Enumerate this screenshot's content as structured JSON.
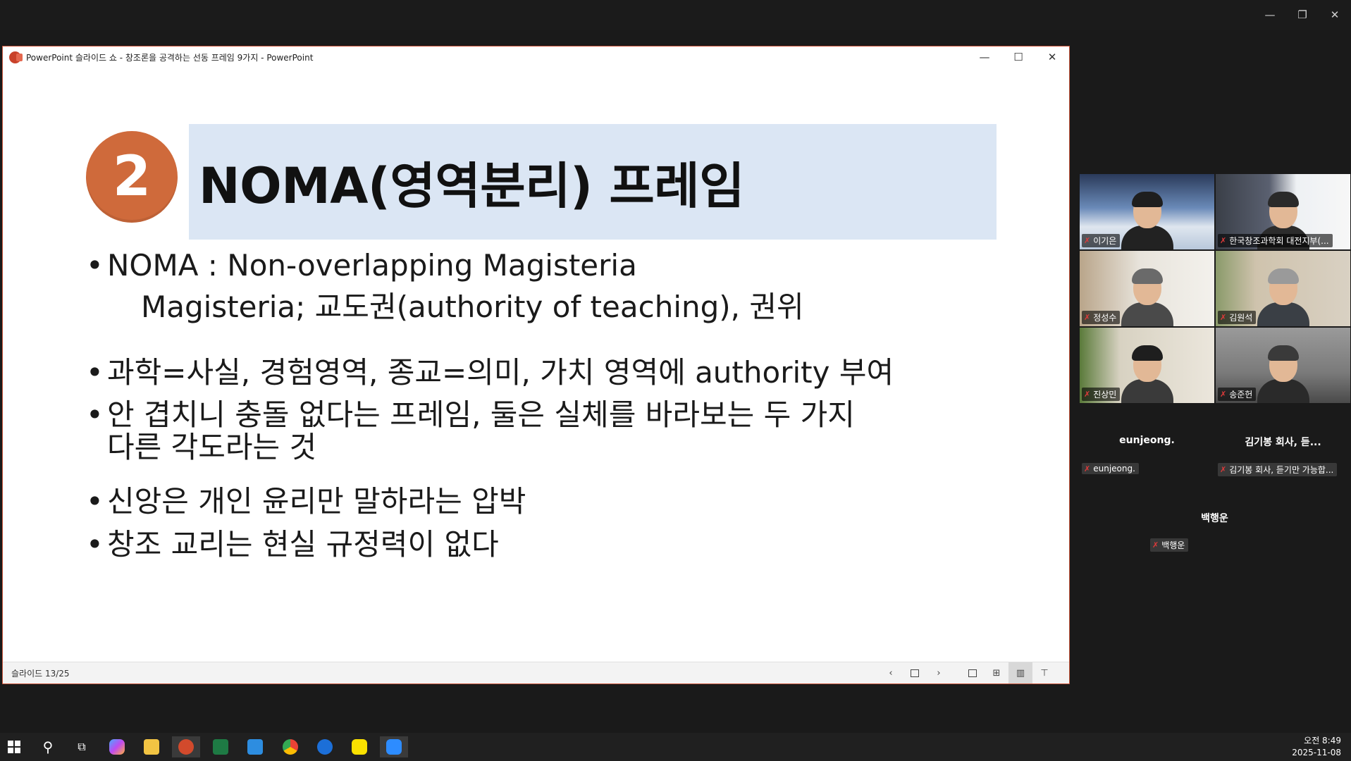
{
  "ppt": {
    "window_title": "PowerPoint 슬라이드 쇼  -  창조론을 공격하는 선동 프레임 9가지 - PowerPoint",
    "slide_counter": "슬라이드 13/25"
  },
  "slide": {
    "number": "2",
    "title": "NOMA(영역분리) 프레임",
    "bullets": [
      {
        "line1": "NOMA : Non-overlapping Magisteria",
        "line2": ""
      },
      {
        "line1": "과학=사실, 경험영역, 종교=의미, 가치 영역에 authority 부여",
        "line2": ""
      },
      {
        "line1": "안 겹치니 충돌 없다는 프레임, 둘은 실체를 바라보는 두 가지",
        "line2": "다른 각도라는 것"
      },
      {
        "line1": "신앙은 개인 윤리만 말하라는 압박",
        "line2": ""
      },
      {
        "line1": "창조 교리는 현실 규정력이 없다",
        "line2": ""
      }
    ],
    "sub_line": "Magisteria; 교도권(authority of teaching), 권위"
  },
  "participants": {
    "tiles": [
      {
        "name": "이기은"
      },
      {
        "name": "한국창조과학회 대전지부(..."
      },
      {
        "name": "정성수"
      },
      {
        "name": "김원석"
      },
      {
        "name": "진상민"
      },
      {
        "name": "송준헌"
      }
    ],
    "name_only": [
      {
        "display": "eunjeong.",
        "tag": "eunjeong."
      },
      {
        "display": "김기봉 회사, 듣...",
        "tag": "김기봉 회사, 듣기만 가능합..."
      },
      {
        "display": "백행운",
        "tag": "백행운"
      }
    ]
  },
  "taskbar": {
    "time": "오전 8:49",
    "date": "2025-11-08"
  },
  "colors": {
    "badge": "#cf6a3b",
    "title_box": "#dbe6f4",
    "speaking_border": "#2fcf74",
    "ppt_accent": "#c9422a"
  }
}
